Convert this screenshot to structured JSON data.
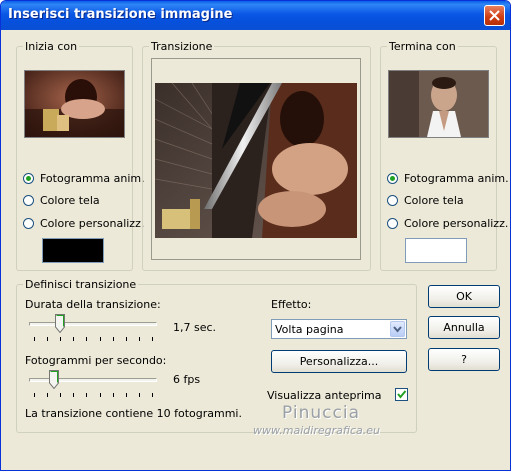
{
  "window": {
    "title": "Inserisci transizione immagine"
  },
  "start_group": {
    "legend": "Inizia con",
    "options": [
      "Fotogramma anim.",
      "Colore tela",
      "Colore personalizz."
    ],
    "selected_index": 0,
    "swatch_color": "#000000"
  },
  "preview_group": {
    "legend": "Transizione"
  },
  "end_group": {
    "legend": "Termina con",
    "options": [
      "Fotogramma anim.",
      "Colore tela",
      "Colore personalizz."
    ],
    "selected_index": 0,
    "swatch_color": "#ffffff"
  },
  "define_group": {
    "legend": "Definisci transizione",
    "duration": {
      "label": "Durata della transizione:",
      "value_text": "1,7 sec.",
      "fraction": 0.22
    },
    "fps": {
      "label": "Fotogrammi per secondo:",
      "value_text": "6 fps",
      "fraction": 0.17
    },
    "info_text": "La transizione contiene 10 fotogrammi.",
    "effect_label": "Effetto:",
    "effect_value": "Volta pagina",
    "customize_label": "Personalizza...",
    "preview_label": "Visualizza anteprima",
    "preview_checked": true
  },
  "buttons": {
    "ok": "OK",
    "cancel": "Annulla",
    "help": "?"
  },
  "watermark": {
    "title": "Pinuccia",
    "url": "www.maidiregrafica.eu"
  }
}
